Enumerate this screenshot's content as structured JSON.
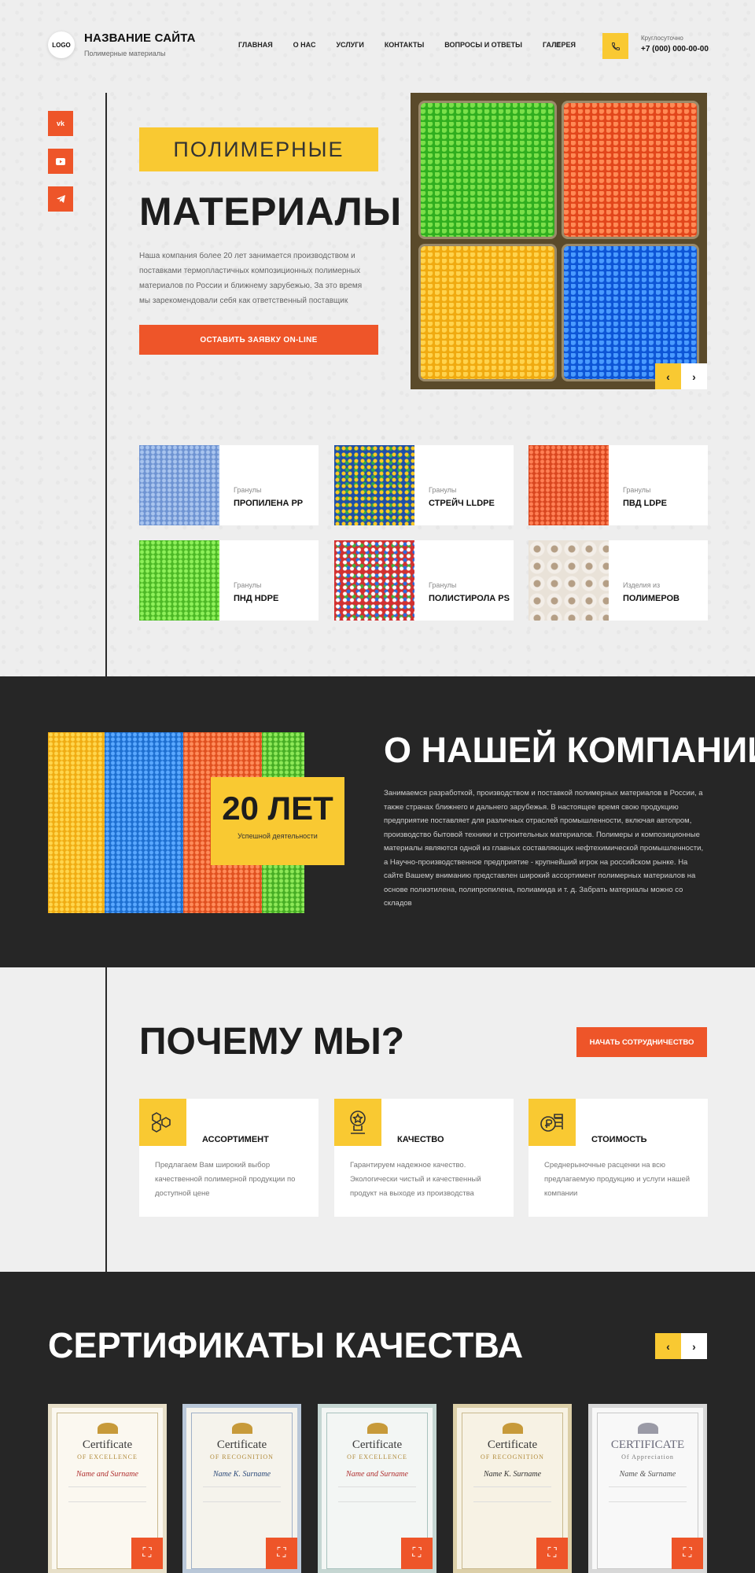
{
  "header": {
    "logo": "LOGO",
    "site_title": "НАЗВАНИЕ САЙТА",
    "site_subtitle": "Полимерные материалы",
    "nav": [
      "ГЛАВНАЯ",
      "О НАС",
      "УСЛУГИ",
      "КОНТАКТЫ",
      "ВОПРОСЫ И ОТВЕТЫ",
      "ГАЛЕРЕЯ"
    ],
    "menu_icon": "≡",
    "phone_caption": "Круглосуточно",
    "phone_number": "+7 (000) 000-00-00"
  },
  "socials": [
    "vk-icon",
    "youtube-icon",
    "telegram-icon"
  ],
  "hero": {
    "tag": "ПОЛИМЕРНЫЕ",
    "title": "МАТЕРИАЛЫ",
    "text": "Наша компания более 20 лет занимается производством и поставками термопластичных композиционных полимерных материалов по России и ближнему зарубежью. За это время мы зарекомендовали себя как ответственный поставщик",
    "button": "ОСТАВИТЬ ЗАЯВКУ ON-LINE",
    "prev": "‹",
    "next": "›"
  },
  "products": [
    {
      "kind": "Гранулы",
      "name": "ПРОПИЛЕНА PP",
      "color": "#7a9fd6"
    },
    {
      "kind": "Гранулы",
      "name": "СТРЕЙЧ LLDPE",
      "color": "#3a7fc0"
    },
    {
      "kind": "Гранулы",
      "name": "ПВД LDPE",
      "color": "#e0522a"
    },
    {
      "kind": "Гранулы",
      "name": "ПНД HDPE",
      "color": "#5cc630"
    },
    {
      "kind": "Гранулы",
      "name": "ПОЛИСТИРОЛА PS",
      "color": "#d23a3a"
    },
    {
      "kind": "Изделия из",
      "name": "ПОЛИМЕРОВ",
      "color": "#e6ddd2"
    }
  ],
  "about": {
    "badge_number": "20 ЛЕТ",
    "badge_caption": "Успешной деятельности",
    "title": "О НАШЕЙ КОМПАНИИ",
    "text": "Занимаемся разработкой, производством и поставкой полимерных материалов в России, а также странах ближнего и дальнего зарубежья. В настоящее время свою продукцию предприятие поставляет для различных отраслей промышленности, включая автопром, производство бытовой техники и строительных материалов. Полимеры и композиционные материалы являются одной из главных составляющих нефтехимической промышленности, а Научно-производственное предприятие - крупнейший игрок на российском рынке. На сайте Вашему вниманию представлен широкий ассортимент полимерных материалов на основе полиэтилена, полипропилена, полиамида и т. д. Забрать материалы можно со складов"
  },
  "why": {
    "title": "ПОЧЕМУ МЫ?",
    "button": "НАЧАТЬ СОТРУДНИЧЕСТВО",
    "cards": [
      {
        "icon": "molecule-icon",
        "title": "АССОРТИМЕНТ",
        "text": "Предлагаем Вам широкий выбор качественной полимерной продукции по доступной цене"
      },
      {
        "icon": "award-icon",
        "title": "КАЧЕСТВО",
        "text": "Гарантируем надежное качество. Экологически чистый и качественный продукт на выходе из производства"
      },
      {
        "icon": "coins-icon",
        "title": "СТОИМОСТЬ",
        "text": "Среднерыночные расценки на всю предлагаемую продукцию и услуги нашей компании"
      }
    ]
  },
  "certs": {
    "title": "СЕРТИФИКАТЫ КАЧЕСТВА",
    "prev": "‹",
    "next": "›",
    "items": [
      {
        "heading": "Certificate",
        "sub": "OF EXCELLENCE",
        "name": "Name and Surname"
      },
      {
        "heading": "Certificate",
        "sub": "OF RECOGNITION",
        "name": "Name K. Surname"
      },
      {
        "heading": "Certificate",
        "sub": "OF EXCELLENCE",
        "name": "Name and Surname"
      },
      {
        "heading": "Certificate",
        "sub": "OF RECOGNITION",
        "name": "Name K. Surname"
      },
      {
        "heading": "CERTIFICATE",
        "sub": "Of Appreciation",
        "name": "Name & Surname"
      }
    ]
  }
}
